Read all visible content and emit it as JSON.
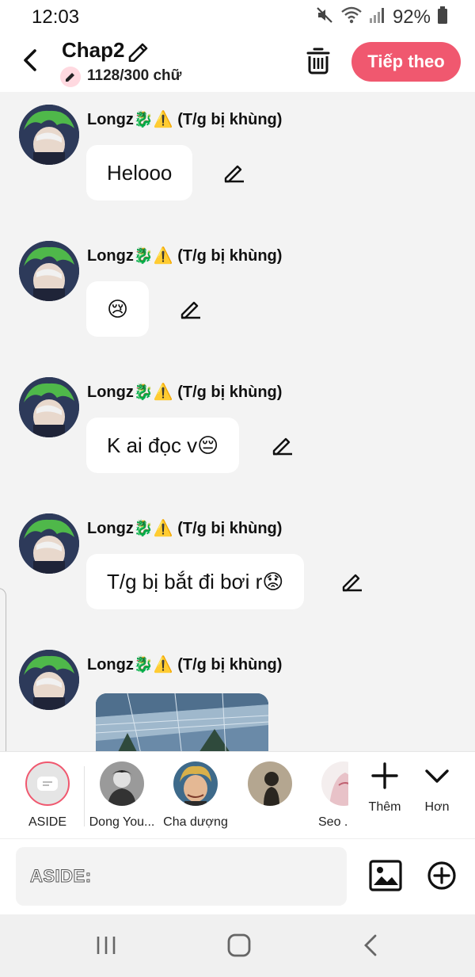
{
  "status": {
    "time": "12:03",
    "battery": "92%",
    "icons": [
      "mute-icon",
      "wifi-icon",
      "signal-icon",
      "battery-icon"
    ]
  },
  "header": {
    "title": "Chap2",
    "word_count": "1128/300 chữ",
    "next_label": "Tiếp theo",
    "accent_color": "#f0586f"
  },
  "messages": [
    {
      "author": "Longz🐉⚠️ (T/g bị khùng)",
      "text": "Helooo"
    },
    {
      "author": "Longz🐉⚠️ (T/g bị khùng)",
      "text": "😢"
    },
    {
      "author": "Longz🐉⚠️ (T/g bị khùng)",
      "text": "K ai đọc v😔"
    },
    {
      "author": "Longz🐉⚠️ (T/g bị khùng)",
      "text": "T/g bị bắt đi bơi r😟"
    },
    {
      "author": "Longz🐉⚠️ (T/g bị khùng)",
      "text": ""
    }
  ],
  "characters": [
    {
      "label": "ASIDE"
    },
    {
      "label": "Dong You..."
    },
    {
      "label": "Cha dượng"
    },
    {
      "label": ""
    },
    {
      "label": "Seo ."
    }
  ],
  "tools": {
    "add_label": "Thêm",
    "more_label": "Hơn"
  },
  "input": {
    "prefix": "ASIDE:"
  }
}
